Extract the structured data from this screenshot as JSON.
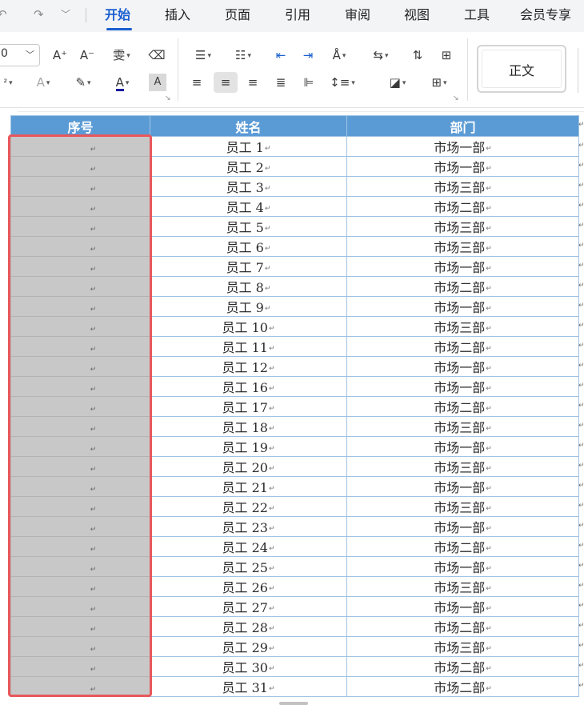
{
  "quick_access": {
    "redo_icon": "redo-icon",
    "more_icon": "chevron-down-icon"
  },
  "tabs": [
    {
      "label": "开始",
      "active": true
    },
    {
      "label": "插入"
    },
    {
      "label": "页面"
    },
    {
      "label": "引用"
    },
    {
      "label": "审阅"
    },
    {
      "label": "视图"
    },
    {
      "label": "工具"
    },
    {
      "label": "会员专享"
    }
  ],
  "ribbon": {
    "font_size_value": "0",
    "font_size_small_value": "²",
    "grow_font": "A⁺",
    "shrink_font": "A⁻",
    "phonetic": "雯",
    "clear_format_icon": "eraser-icon",
    "text_effect": "A",
    "highlight_icon": "highlighter-icon",
    "font_color": "A",
    "char_shading": "A",
    "style_normal_label": "正文",
    "accent_color": "#1a5fd0",
    "font_color_bar": "#1a1a9e"
  },
  "table": {
    "headers": [
      "序号",
      "姓名",
      "部门"
    ],
    "header_color": "#5b9bd5",
    "selection_color": "#e8585c",
    "rows": [
      {
        "name": "员工 1",
        "dept": "市场一部"
      },
      {
        "name": "员工 2",
        "dept": "市场一部"
      },
      {
        "name": "员工 3",
        "dept": "市场三部"
      },
      {
        "name": "员工 4",
        "dept": "市场二部"
      },
      {
        "name": "员工 5",
        "dept": "市场三部"
      },
      {
        "name": "员工 6",
        "dept": "市场三部"
      },
      {
        "name": "员工 7",
        "dept": "市场一部"
      },
      {
        "name": "员工 8",
        "dept": "市场二部"
      },
      {
        "name": "员工 9",
        "dept": "市场一部"
      },
      {
        "name": "员工 10",
        "dept": "市场三部"
      },
      {
        "name": "员工 11",
        "dept": "市场二部"
      },
      {
        "name": "员工 12",
        "dept": "市场一部"
      },
      {
        "name": "员工 16",
        "dept": "市场一部"
      },
      {
        "name": "员工 17",
        "dept": "市场二部"
      },
      {
        "name": "员工 18",
        "dept": "市场三部"
      },
      {
        "name": "员工 19",
        "dept": "市场一部"
      },
      {
        "name": "员工 20",
        "dept": "市场三部"
      },
      {
        "name": "员工 21",
        "dept": "市场一部"
      },
      {
        "name": "员工 22",
        "dept": "市场三部"
      },
      {
        "name": "员工 23",
        "dept": "市场一部"
      },
      {
        "name": "员工 24",
        "dept": "市场二部"
      },
      {
        "name": "员工 25",
        "dept": "市场一部"
      },
      {
        "name": "员工 26",
        "dept": "市场三部"
      },
      {
        "name": "员工 27",
        "dept": "市场一部"
      },
      {
        "name": "员工 28",
        "dept": "市场二部"
      },
      {
        "name": "员工 29",
        "dept": "市场三部"
      },
      {
        "name": "员工 30",
        "dept": "市场二部"
      },
      {
        "name": "员工 31",
        "dept": "市场二部"
      }
    ]
  }
}
